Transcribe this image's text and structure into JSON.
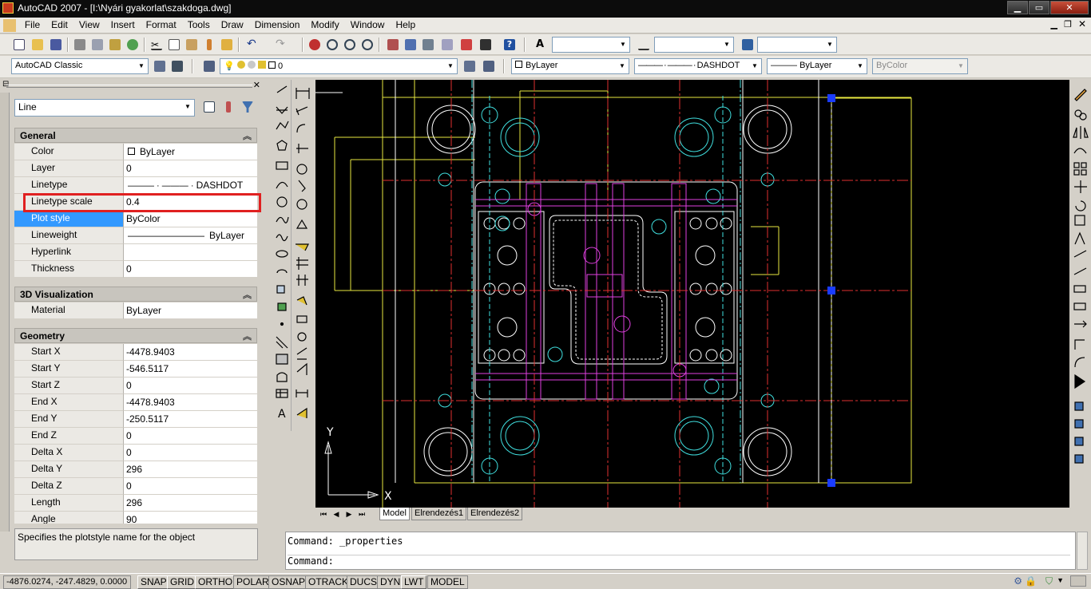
{
  "window": {
    "title": "AutoCAD 2007 - [I:\\Nyári gyakorlat\\szakdoga.dwg]"
  },
  "menubar": {
    "items": [
      "File",
      "Edit",
      "View",
      "Insert",
      "Format",
      "Tools",
      "Draw",
      "Dimension",
      "Modify",
      "Window",
      "Help"
    ]
  },
  "toolbar2": {
    "workspace": "AutoCAD Classic",
    "layer": "0",
    "color": "ByLayer",
    "linetype": "DASHDOT",
    "lineweight": "ByLayer",
    "plotstyle": "ByColor"
  },
  "properties": {
    "object_type": "Line",
    "sections": [
      {
        "name": "General",
        "rows": [
          {
            "key": "Color",
            "value": "ByLayer"
          },
          {
            "key": "Layer",
            "value": "0"
          },
          {
            "key": "Linetype",
            "value": "DASHDOT"
          },
          {
            "key": "Linetype scale",
            "value": "0.4"
          },
          {
            "key": "Plot style",
            "value": "ByColor"
          },
          {
            "key": "Lineweight",
            "value": "ByLayer"
          },
          {
            "key": "Hyperlink",
            "value": ""
          },
          {
            "key": "Thickness",
            "value": "0"
          }
        ]
      },
      {
        "name": "3D Visualization",
        "rows": [
          {
            "key": "Material",
            "value": "ByLayer"
          }
        ]
      },
      {
        "name": "Geometry",
        "rows": [
          {
            "key": "Start X",
            "value": "-4478.9403"
          },
          {
            "key": "Start Y",
            "value": "-546.5117"
          },
          {
            "key": "Start Z",
            "value": "0"
          },
          {
            "key": "End X",
            "value": "-4478.9403"
          },
          {
            "key": "End Y",
            "value": "-250.5117"
          },
          {
            "key": "End Z",
            "value": "0"
          },
          {
            "key": "Delta X",
            "value": "0"
          },
          {
            "key": "Delta Y",
            "value": "296"
          },
          {
            "key": "Delta Z",
            "value": "0"
          },
          {
            "key": "Length",
            "value": "296"
          },
          {
            "key": "Angle",
            "value": "90"
          }
        ]
      }
    ],
    "description": "Specifies the plotstyle name for the object"
  },
  "layout_tabs": [
    "Model",
    "Elrendezés1",
    "Elrendezés2"
  ],
  "command": {
    "line1": "Command: _properties",
    "line2": "Command:"
  },
  "ucs": {
    "x_label": "X",
    "y_label": "Y"
  },
  "statusbar": {
    "coords": "-4876.0274, -247.4829, 0.0000",
    "toggles": [
      "SNAP",
      "GRID",
      "ORTHO",
      "POLAR",
      "OSNAP",
      "OTRACK",
      "DUCS",
      "DYN",
      "LWT",
      "MODEL"
    ]
  },
  "colors": {
    "canvas": "#000000",
    "highlight": "#e02020",
    "selection": "#3399ff"
  }
}
